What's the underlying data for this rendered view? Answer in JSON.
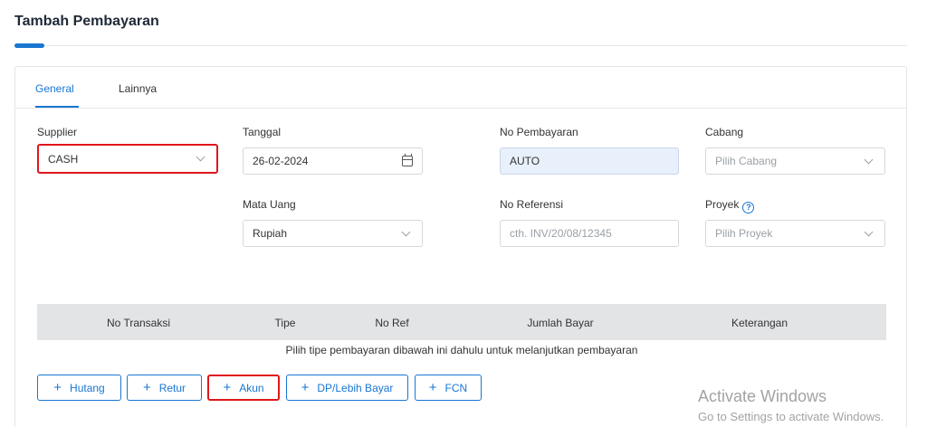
{
  "page": {
    "title": "Tambah Pembayaran"
  },
  "tabs": [
    {
      "label": "General",
      "active": true
    },
    {
      "label": "Lainnya",
      "active": false
    }
  ],
  "form": {
    "supplier": {
      "label": "Supplier",
      "value": "CASH"
    },
    "tanggal": {
      "label": "Tanggal",
      "value": "26-02-2024"
    },
    "no_pembayaran": {
      "label": "No Pembayaran",
      "value": "AUTO"
    },
    "cabang": {
      "label": "Cabang",
      "placeholder": "Pilih Cabang"
    },
    "mata_uang": {
      "label": "Mata Uang",
      "value": "Rupiah"
    },
    "no_referensi": {
      "label": "No Referensi",
      "placeholder": "cth. INV/20/08/12345"
    },
    "proyek": {
      "label": "Proyek",
      "placeholder": "Pilih Proyek"
    }
  },
  "table": {
    "headers": [
      "No Transaksi",
      "Tipe",
      "No Ref",
      "Jumlah Bayar",
      "Keterangan"
    ],
    "empty_message": "Pilih tipe pembayaran dibawah ini dahulu untuk melanjutkan pembayaran"
  },
  "buttons": [
    {
      "label": "Hutang",
      "icon": "plus-icon"
    },
    {
      "label": "Retur",
      "icon": "plus-icon"
    },
    {
      "label": "Akun",
      "icon": "plus-icon"
    },
    {
      "label": "DP/Lebih Bayar",
      "icon": "plus-icon"
    },
    {
      "label": "FCN",
      "icon": "plus-icon"
    }
  ],
  "watermark": {
    "title": "Activate Windows",
    "subtitle": "Go to Settings to activate Windows."
  },
  "colors": {
    "accent": "#1976d2",
    "highlight": "#e0161c",
    "auto_field": "#e8f0fb"
  }
}
